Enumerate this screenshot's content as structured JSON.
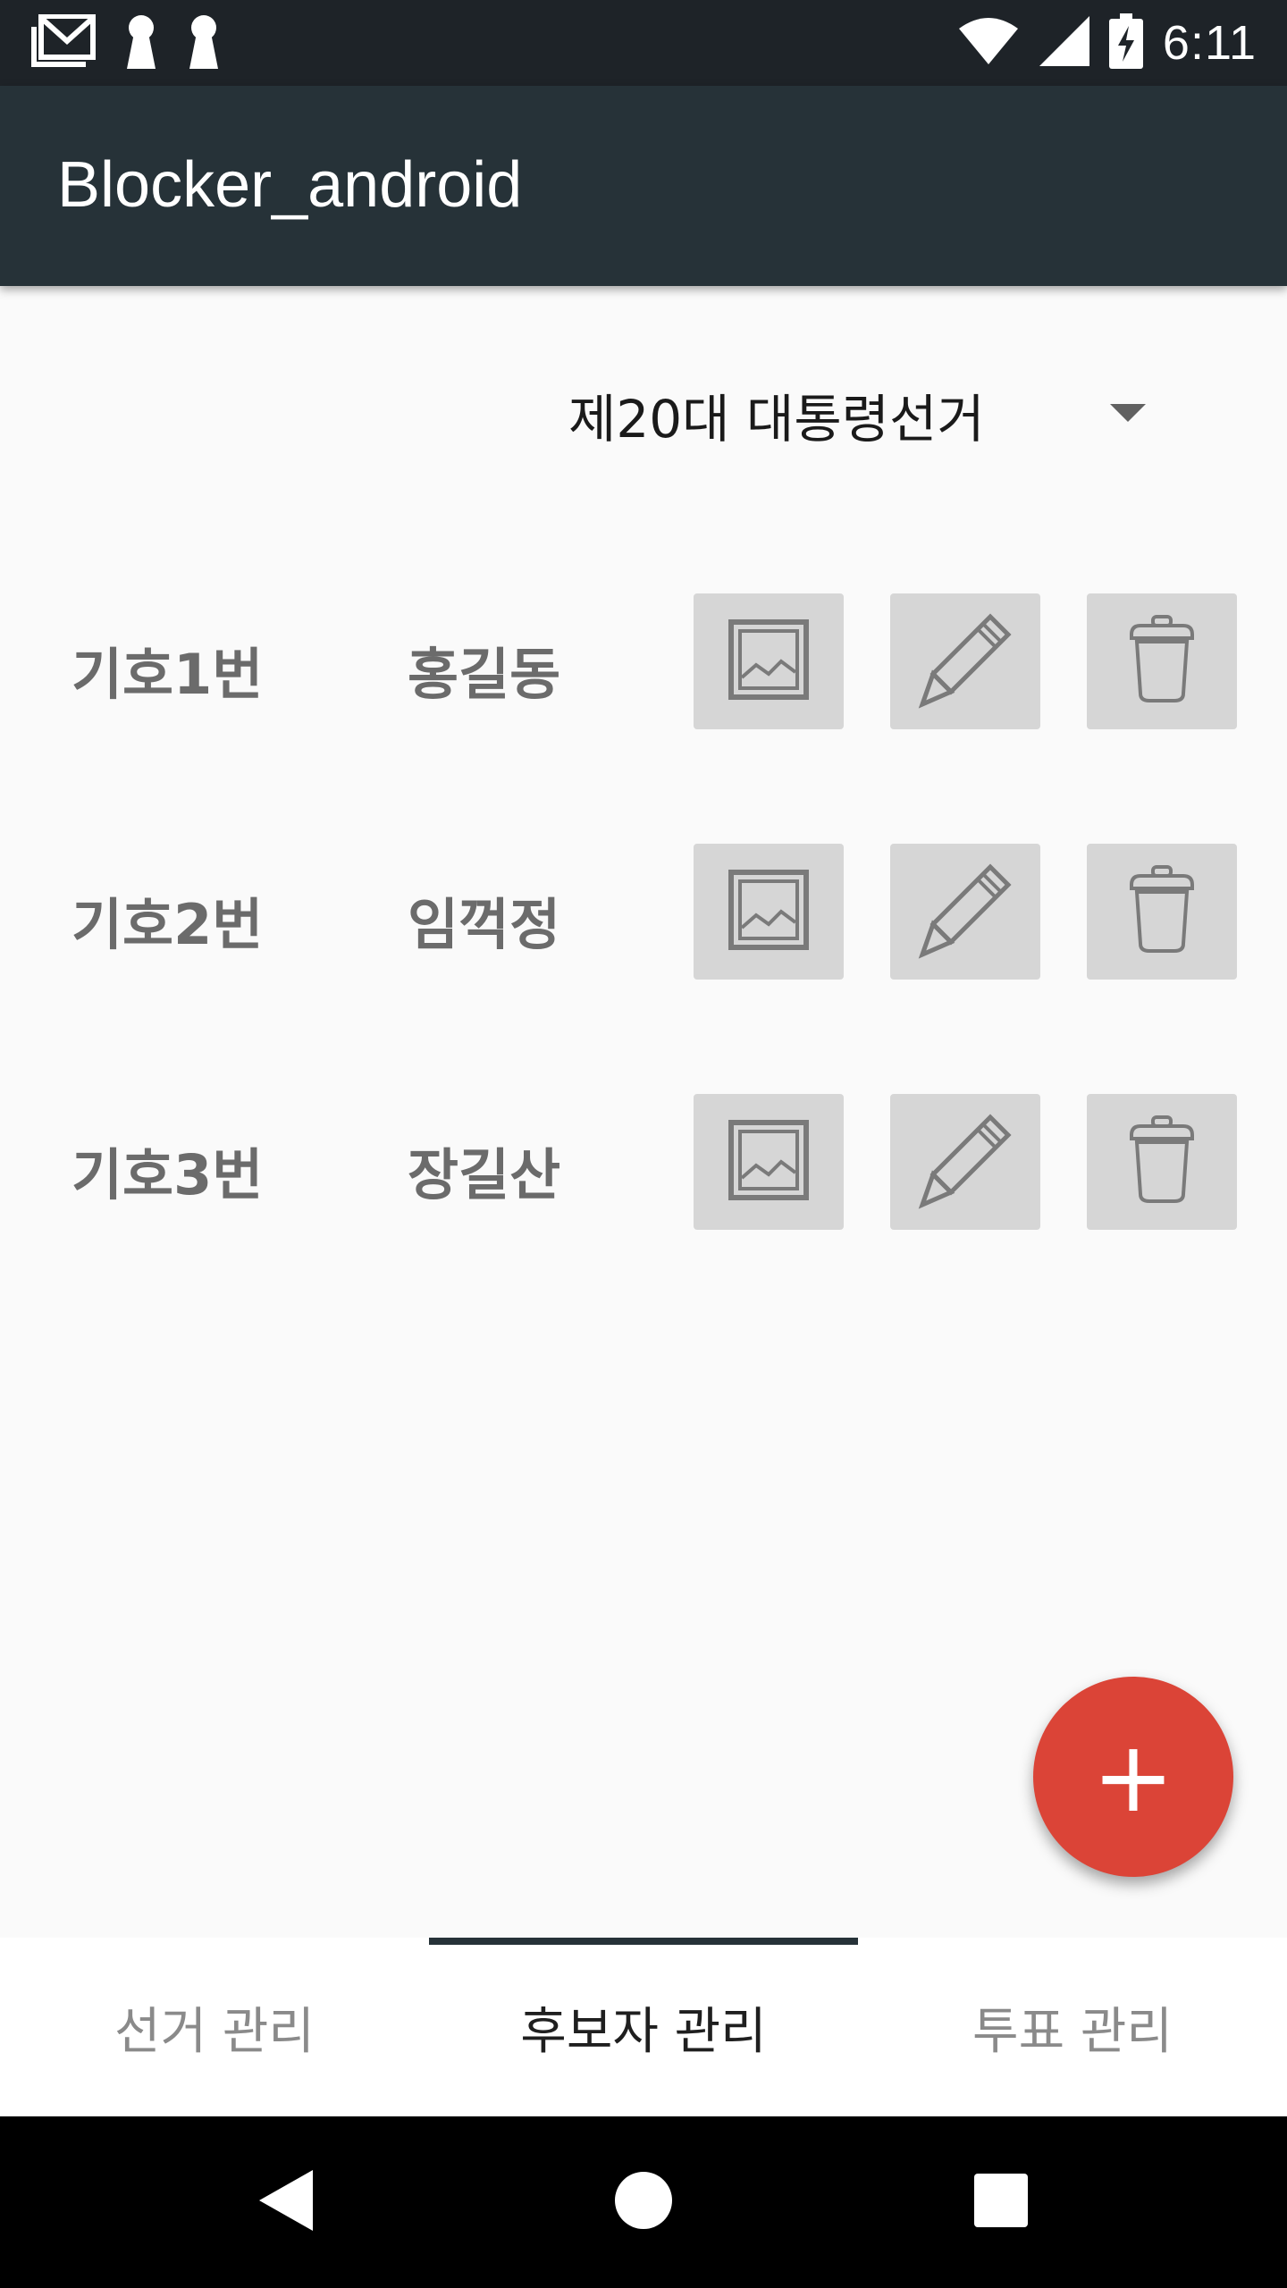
{
  "status_bar": {
    "time": "6:11",
    "icons": [
      "gmail-icon",
      "keyhole-icon",
      "keyhole-icon",
      "wifi-icon",
      "signal-icon",
      "battery-charging-icon"
    ]
  },
  "app_bar": {
    "title": "Blocker_android",
    "background_color": "#263238"
  },
  "election_spinner": {
    "selected": "제20대 대통령선거"
  },
  "candidates": [
    {
      "number_label": "기호1번",
      "name": "홍길동"
    },
    {
      "number_label": "기호2번",
      "name": "임꺽정"
    },
    {
      "number_label": "기호3번",
      "name": "장길산"
    }
  ],
  "row_actions": [
    "image-icon",
    "pencil-icon",
    "trash-icon"
  ],
  "fab": {
    "label": "+",
    "color": "#db4437"
  },
  "tabs": {
    "items": [
      {
        "label": "선거 관리",
        "active": false
      },
      {
        "label": "후보자 관리",
        "active": true
      },
      {
        "label": "투표 관리",
        "active": false
      }
    ]
  },
  "nav_bar": {
    "buttons": [
      "back-icon",
      "home-icon",
      "recents-icon"
    ]
  }
}
